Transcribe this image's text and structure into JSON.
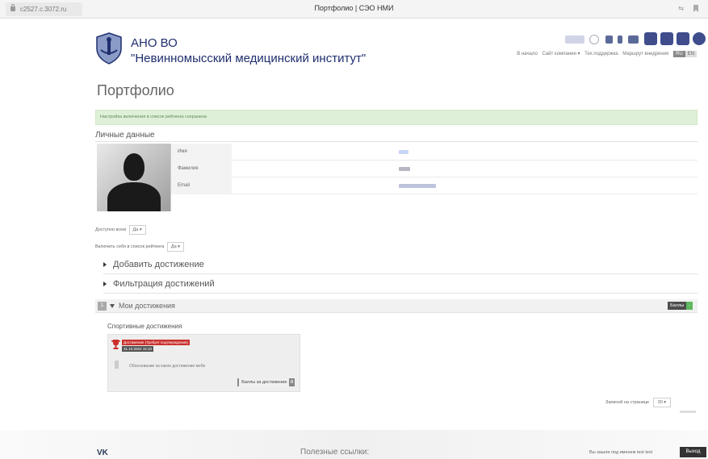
{
  "browser": {
    "url": "c2527.c.3072.ru",
    "title": "Портфолио | СЭО НМИ"
  },
  "header": {
    "org_abbr": "АНО ВО",
    "org_name": "\"Невинномысский медицинский институт\"",
    "nav": {
      "home": "В начало",
      "company_site": "Сайт компании ▾",
      "support": "Тех.поддержка",
      "route": "Маршрут внедрения",
      "lang_ru": "RU",
      "lang_en": "EN"
    }
  },
  "page": {
    "title": "Портфолио"
  },
  "alert": {
    "text": "Настройка включения в список рейтинга сохранена"
  },
  "personal": {
    "title": "Личные данные",
    "rows": [
      {
        "label": "Имя"
      },
      {
        "label": "Фамилия"
      },
      {
        "label": "Email"
      }
    ]
  },
  "settings": {
    "available_label": "Доступно всем",
    "available_value": "Да ▾",
    "rating_label": "Включить себя в список рейтинга",
    "rating_value": "Да ▾"
  },
  "accordion": {
    "add": "Добавить достижение",
    "filter": "Фильтрация достижений"
  },
  "achievements": {
    "count": "1",
    "title": "Мои достижения",
    "points_label": "Баллы",
    "points_value": "-",
    "category": "Спортивные достижения",
    "card": {
      "status": "Достижение (Требует подтверждения)",
      "date": "31.10.2024 15:10",
      "description": "Обоснование за какое достижение мебе",
      "points_button": "Баллы за достижение",
      "points_value": "0"
    }
  },
  "pagination": {
    "label": "Записей на странице",
    "value": "30 ▾"
  },
  "footer": {
    "vk": "VK",
    "useful_links": "Полезные ссылки:",
    "logged_in_as": "Вы зашли под именем",
    "username": "test test",
    "logout": "Выход"
  },
  "colors": {
    "brand": "#1f2f6e",
    "alert_bg": "#dff0d8",
    "status_red": "#c9302c",
    "points_green": "#5cb85c"
  }
}
